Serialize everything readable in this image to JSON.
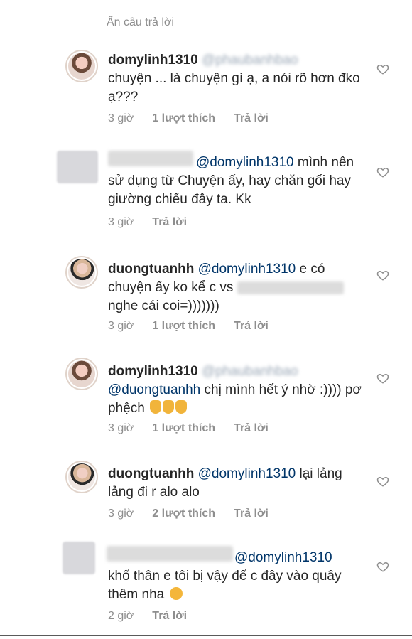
{
  "hide_replies": "Ẩn câu trả lời",
  "comments": [
    {
      "user": "domylinh1310",
      "mention": "@phaubanhbao",
      "text": "chuyện ... là chuyện gì ạ, a nói rõ hơn đko ạ???",
      "time": "3 giờ",
      "likes": "1 lượt thích",
      "reply": "Trả lời"
    },
    {
      "user": "",
      "mention": "@domylinh1310",
      "text": "mình nên sử dụng từ Chuyện ấy, hay chăn gối hay giường chiếu đây ta. Kk",
      "time": "3 giờ",
      "likes": "",
      "reply": "Trả lời"
    },
    {
      "user": "duongtuanhh",
      "mention": "@domylinh1310",
      "text": "e có chuyện ấy ko kể c vs",
      "text2": "nghe cái coi=)))))))",
      "time": "3 giờ",
      "likes": "1 lượt thích",
      "reply": "Trả lời"
    },
    {
      "user": "domylinh1310",
      "mention": "@phaubanhbao",
      "mention2": "@duongtuanhh",
      "text": "chị mình hết ý nhờ :)))) pơ phệch",
      "time": "3 giờ",
      "likes": "1 lượt thích",
      "reply": "Trả lời"
    },
    {
      "user": "duongtuanhh",
      "mention": "@domylinh1310",
      "text": "lại lảng lảng đi r alo alo",
      "time": "3 giờ",
      "likes": "2 lượt thích",
      "reply": "Trả lời"
    },
    {
      "user": "",
      "mention": "@domylinh1310",
      "text": "khổ thân e tôi bị vậy để c đây vào quây thêm nha",
      "time": "2 giờ",
      "likes": "",
      "reply": "Trả lời"
    }
  ],
  "colors": {
    "text": "#262626",
    "meta": "#8e8e8e",
    "mention": "#003569"
  },
  "icons": {
    "like": "heart-outline-icon"
  }
}
